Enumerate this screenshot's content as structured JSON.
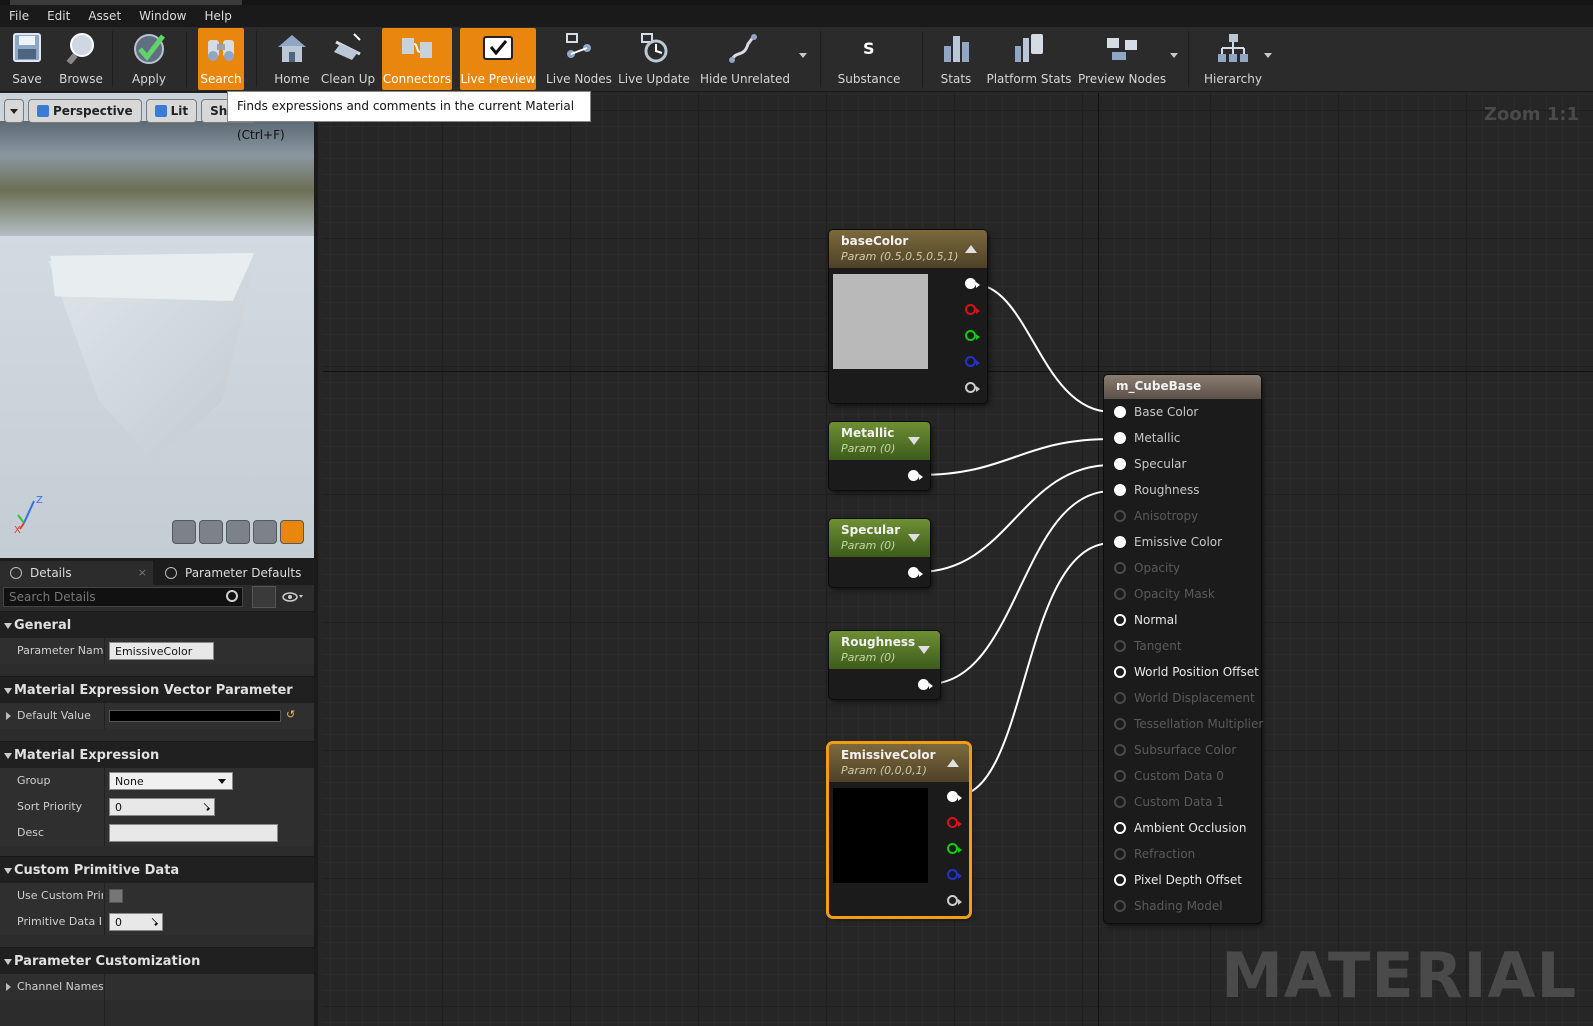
{
  "menu": [
    "File",
    "Edit",
    "Asset",
    "Window",
    "Help"
  ],
  "toolbar": {
    "buttons": [
      {
        "label": "Save",
        "icon": "save-icon"
      },
      {
        "label": "Browse",
        "icon": "browse-icon"
      },
      {
        "label": "Apply",
        "icon": "apply-check-icon"
      },
      {
        "label": "Search",
        "icon": "search-binoculars-icon",
        "active": true
      },
      {
        "label": "Home",
        "icon": "home-icon"
      },
      {
        "label": "Clean Up",
        "icon": "clean-up-icon"
      },
      {
        "label": "Connectors",
        "icon": "connectors-icon",
        "active": true
      },
      {
        "label": "Live Preview",
        "icon": "live-preview-icon",
        "active": true
      },
      {
        "label": "Live Nodes",
        "icon": "live-nodes-icon"
      },
      {
        "label": "Live Update",
        "icon": "live-update-icon"
      },
      {
        "label": "Hide Unrelated",
        "icon": "hide-unrelated-icon"
      },
      {
        "label": "Substance",
        "icon": "substance-icon"
      },
      {
        "label": "Stats",
        "icon": "stats-icon"
      },
      {
        "label": "Platform Stats",
        "icon": "platform-stats-icon"
      },
      {
        "label": "Preview Nodes",
        "icon": "preview-nodes-icon"
      },
      {
        "label": "Hierarchy",
        "icon": "hierarchy-icon"
      }
    ]
  },
  "tooltip": "Finds expressions and comments in the current Material (Ctrl+F)",
  "viewport": {
    "perspective_label": "Perspective",
    "lit_label": "Lit",
    "show_label": "Show",
    "axis_z": "Z",
    "axis_x": "X"
  },
  "details": {
    "tab_details": "Details",
    "tab_params": "Parameter Defaults",
    "search_placeholder": "Search Details",
    "categories": {
      "general": "General",
      "vector_param": "Material Expression Vector Parameter",
      "material_expression": "Material Expression",
      "custom_primitive": "Custom Primitive Data",
      "param_customization": "Parameter Customization"
    },
    "props": {
      "parameter_name_label": "Parameter Name",
      "parameter_name_value": "EmissiveColor",
      "default_value_label": "Default Value",
      "group_label": "Group",
      "group_value": "None",
      "sort_priority_label": "Sort Priority",
      "sort_priority_value": "0",
      "desc_label": "Desc",
      "desc_value": "",
      "use_custom_prim_label": "Use Custom Prim",
      "primitive_data_label": "Primitive Data Inc",
      "primitive_data_value": "0",
      "channel_names_label": "Channel Names"
    }
  },
  "graph": {
    "zoom": "Zoom 1:1",
    "watermark": "MATERIAL",
    "nodes": {
      "basecolor": {
        "title": "baseColor",
        "sub": "Param (0.5,0.5,0.5,1)",
        "swatch": "#b9b9b9"
      },
      "metallic": {
        "title": "Metallic",
        "sub": "Param (0)"
      },
      "specular": {
        "title": "Specular",
        "sub": "Param (0)"
      },
      "roughness": {
        "title": "Roughness",
        "sub": "Param (0)"
      },
      "emissive": {
        "title": "EmissiveColor",
        "sub": "Param (0,0,0,1)",
        "swatch": "#000000"
      }
    },
    "result": {
      "title": "m_CubeBase",
      "inputs": [
        {
          "label": "Base Color",
          "state": "con"
        },
        {
          "label": "Metallic",
          "state": "con"
        },
        {
          "label": "Specular",
          "state": "con"
        },
        {
          "label": "Roughness",
          "state": "con"
        },
        {
          "label": "Anisotropy",
          "state": "dim"
        },
        {
          "label": "Emissive Color",
          "state": "con"
        },
        {
          "label": "Opacity",
          "state": "dim"
        },
        {
          "label": "Opacity Mask",
          "state": "dim"
        },
        {
          "label": "Normal",
          "state": "act"
        },
        {
          "label": "Tangent",
          "state": "dim"
        },
        {
          "label": "World Position Offset",
          "state": "act"
        },
        {
          "label": "World Displacement",
          "state": "dim"
        },
        {
          "label": "Tessellation Multiplier",
          "state": "dim"
        },
        {
          "label": "Subsurface Color",
          "state": "dim"
        },
        {
          "label": "Custom Data 0",
          "state": "dim"
        },
        {
          "label": "Custom Data 1",
          "state": "dim"
        },
        {
          "label": "Ambient Occlusion",
          "state": "act"
        },
        {
          "label": "Refraction",
          "state": "dim"
        },
        {
          "label": "Pixel Depth Offset",
          "state": "act"
        },
        {
          "label": "Shading Model",
          "state": "dim"
        }
      ]
    }
  },
  "colors": {
    "accent": "#e8860d",
    "selection": "#f29d16"
  }
}
